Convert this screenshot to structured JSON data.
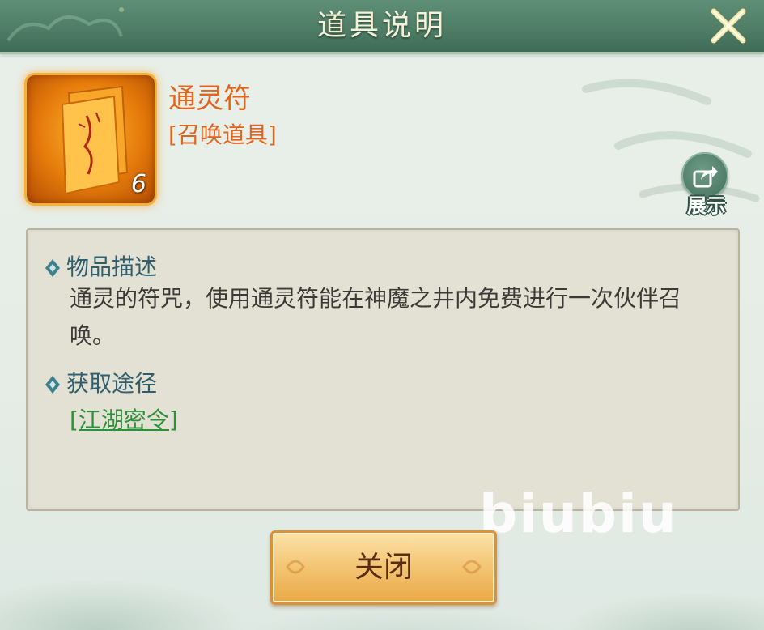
{
  "dialog": {
    "title": "道具说明",
    "close_icon": "close-x-icon"
  },
  "item": {
    "name": "通灵符",
    "type": "[召唤道具]",
    "count": "6",
    "icon": "talisman-scroll-icon"
  },
  "share": {
    "label": "展示",
    "icon": "share-arrow-icon"
  },
  "description": {
    "heading": "物品描述",
    "text": "通灵的符咒，使用通灵符能在神魔之井内免费进行一次伙伴召唤。"
  },
  "source": {
    "heading": "获取途径",
    "link": "[江湖密令]"
  },
  "footer": {
    "close_label": "关闭"
  },
  "watermark": "biubiu",
  "colors": {
    "header": "#4f7d66",
    "item_name": "#e0651e",
    "section_heading": "#2f5f6e",
    "link": "#2f8f3a",
    "button": "#f4c777"
  }
}
